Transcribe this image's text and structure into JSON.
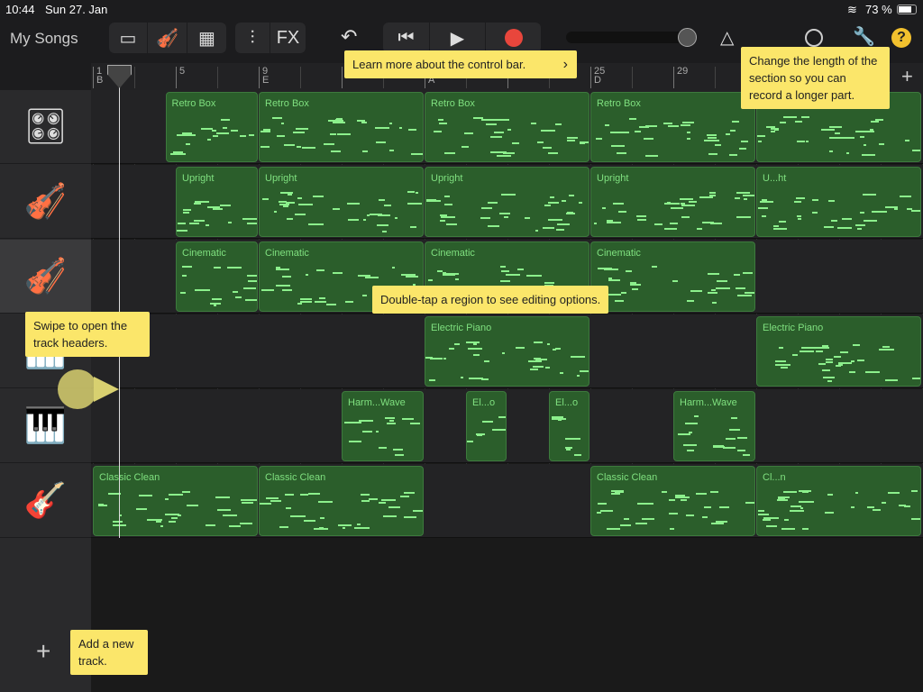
{
  "status": {
    "time": "10:44",
    "date": "Sun 27. Jan",
    "battery": "73 %"
  },
  "toolbar": {
    "my_songs": "My Songs",
    "fx": "FX"
  },
  "ruler": {
    "markers": [
      {
        "bar": 1,
        "label": "1",
        "section": "B"
      },
      {
        "bar": 5,
        "label": "5",
        "section": ""
      },
      {
        "bar": 9,
        "label": "9",
        "section": "E"
      },
      {
        "bar": 17,
        "label": "",
        "section": "A"
      },
      {
        "bar": 25,
        "label": "25",
        "section": "D"
      },
      {
        "bar": 29,
        "label": "29",
        "section": ""
      }
    ]
  },
  "tracks": [
    {
      "instrument": "drum-machine",
      "regions": [
        {
          "label": "Retro Box",
          "start": 4.5,
          "end": 9
        },
        {
          "label": "Retro Box",
          "start": 9,
          "end": 17
        },
        {
          "label": "Retro Box",
          "start": 17,
          "end": 25
        },
        {
          "label": "Retro Box",
          "start": 25,
          "end": 33
        },
        {
          "label": "Retro Box",
          "start": 33,
          "end": 41
        }
      ]
    },
    {
      "instrument": "upright-bass",
      "regions": [
        {
          "label": "Upright",
          "start": 5,
          "end": 9
        },
        {
          "label": "Upright",
          "start": 9,
          "end": 17
        },
        {
          "label": "Upright",
          "start": 17,
          "end": 25
        },
        {
          "label": "Upright",
          "start": 25,
          "end": 33
        },
        {
          "label": "U...ht",
          "start": 33,
          "end": 41
        }
      ]
    },
    {
      "instrument": "strings",
      "regions": [
        {
          "label": "Cinematic",
          "start": 5,
          "end": 9
        },
        {
          "label": "Cinematic",
          "start": 9,
          "end": 17
        },
        {
          "label": "Cinematic",
          "start": 17,
          "end": 25
        },
        {
          "label": "Cinematic",
          "start": 25,
          "end": 33
        }
      ]
    },
    {
      "instrument": "electric-piano",
      "regions": [
        {
          "label": "Electric Piano",
          "start": 17,
          "end": 25
        },
        {
          "label": "Electric Piano",
          "start": 33,
          "end": 41
        }
      ]
    },
    {
      "instrument": "synth-keyboard",
      "regions": [
        {
          "label": "Harm...Wave",
          "start": 13,
          "end": 17
        },
        {
          "label": "El...o",
          "start": 19,
          "end": 21
        },
        {
          "label": "El...o",
          "start": 23,
          "end": 25
        },
        {
          "label": "Harm...Wave",
          "start": 29,
          "end": 33
        }
      ]
    },
    {
      "instrument": "electric-guitar",
      "regions": [
        {
          "label": "Classic Clean",
          "start": 1,
          "end": 9
        },
        {
          "label": "Classic Clean",
          "start": 9,
          "end": 17
        },
        {
          "label": "Classic Clean",
          "start": 25,
          "end": 33
        },
        {
          "label": "Cl...n",
          "start": 33,
          "end": 41
        }
      ]
    }
  ],
  "tips": {
    "control_bar": "Learn more about the control bar.",
    "section_length": "Change the length of the section so you can record a longer part.",
    "double_tap": "Double-tap a region to see editing options.",
    "swipe": "Swipe to open the track headers.",
    "add_track": "Add a new track."
  },
  "colors": {
    "region": "#2b5e2b",
    "note": "#8cf08c",
    "tip": "#fbe66a",
    "record": "#e8463c"
  }
}
